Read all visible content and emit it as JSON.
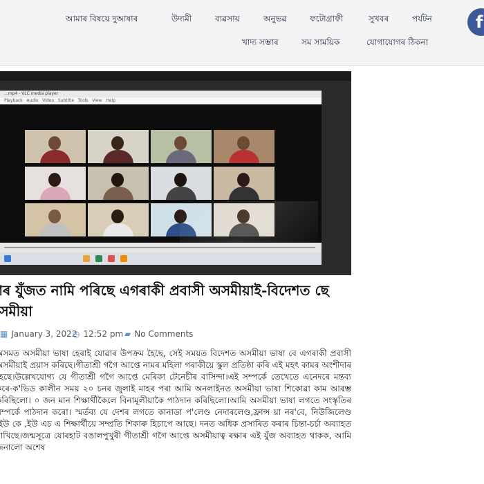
{
  "nav": {
    "row1": [
      "আমাৰ বিষয়ে দুআষাৰ",
      "উদ্যমী",
      "ব্যৱসায়",
      "অনুভৱ",
      "ফটোগ্ৰাফী",
      "সুখবৰ",
      "পৰ্যটন"
    ],
    "row2": [
      "খাদ্য সম্ভাৰ",
      "সম সাময়িক",
      "যোগাযোগৰ ঠিকনা"
    ]
  },
  "social": {
    "facebook_glyph": "f",
    "icon": "facebook-icon"
  },
  "photo": {
    "window_title": "...mp4 - VLC media player",
    "menu": [
      "Playback",
      "Audio",
      "Video",
      "Subtitle",
      "Tools",
      "View",
      "Help"
    ]
  },
  "article": {
    "title": "ক্ষাৰ যুঁজত নামি পৰিছে এগৰাকী প্ৰবাসী অসমীয়াই-বিদেশত ছে অসমীয়া",
    "date": "January 3, 2022",
    "time": "12:52 pm",
    "comments": "No Comments",
    "body": "অসমত অসমীয়া ভাষা হেৰাই যোৱাৰ উপক্ৰম হৈছে, সেই সময়ত বিদেশত অসমীয়া ভাষা বে এগৰাকী প্ৰবাসী অসমীয়াই প্ৰয়াস কৰিছে।গীতাশ্ৰী গগৈ আপ্তে নামৰ মহিলা গৰাকীয়ে স্কুল প্ৰতিষ্ঠা কৰি এই মহৎ কামৰ অংশীদাৰ হৈছে।উল্লেখযোগ্য যে গীতাশ্ৰী গগৈ আপ্তে মেৰিকা টেনেচীৰ বাসিন্দা।এই সম্পৰ্কে তেখেতে এনেদৰে মন্তব্য কৰে-ক'ভিড কালীন সময় ২০ চনৰ জুলাই মাহৰ পৰা আমি অনলাইনত অসমীয়া ভাষা শিকোৱা কাম আৰম্ভ কৰিছিলো। ০ জন মান শিক্ষাৰ্থীকৈলে বিনামূলীয়াকৈ পাঠদান কৰিছিলো।আমি অসমীয়া ভাষা লগতে সংস্কৃতিৰ সম্পৰ্কে পাঠদান কৰো। স্মৰ্তব্য যে দেশৰ লগতে কানাডা প'লেণ্ড নেদাৰলেণ্ড,ফ্ৰান্স য়া নৰ'বে, নিউজিলেণ্ড ,ইউ কে ,ইউ এচ এ শিক্ষাৰ্থীয়ে সম্প্ৰতি শিকাৰু হিচাপে আছে। দনত অধিক প্ৰসাৰিত কৰাৰ চিন্তা-চৰ্চা অব্যাহত ৰাখিছে।জন্মসূত্ৰে যোৰহাট বঙালপুখুৰী গীতাশ্ৰী গগৈ আপ্তে অসমীয়াত্ব ৰক্ষাৰ এই যুঁজ অব্যাহত থাকক, আমি জনালো অশেষ"
  },
  "colors": {
    "accent": "#5b8fc7",
    "facebook": "#3b5998",
    "nav_text": "#1f2a44",
    "header_bg": "#f3f3f3"
  }
}
